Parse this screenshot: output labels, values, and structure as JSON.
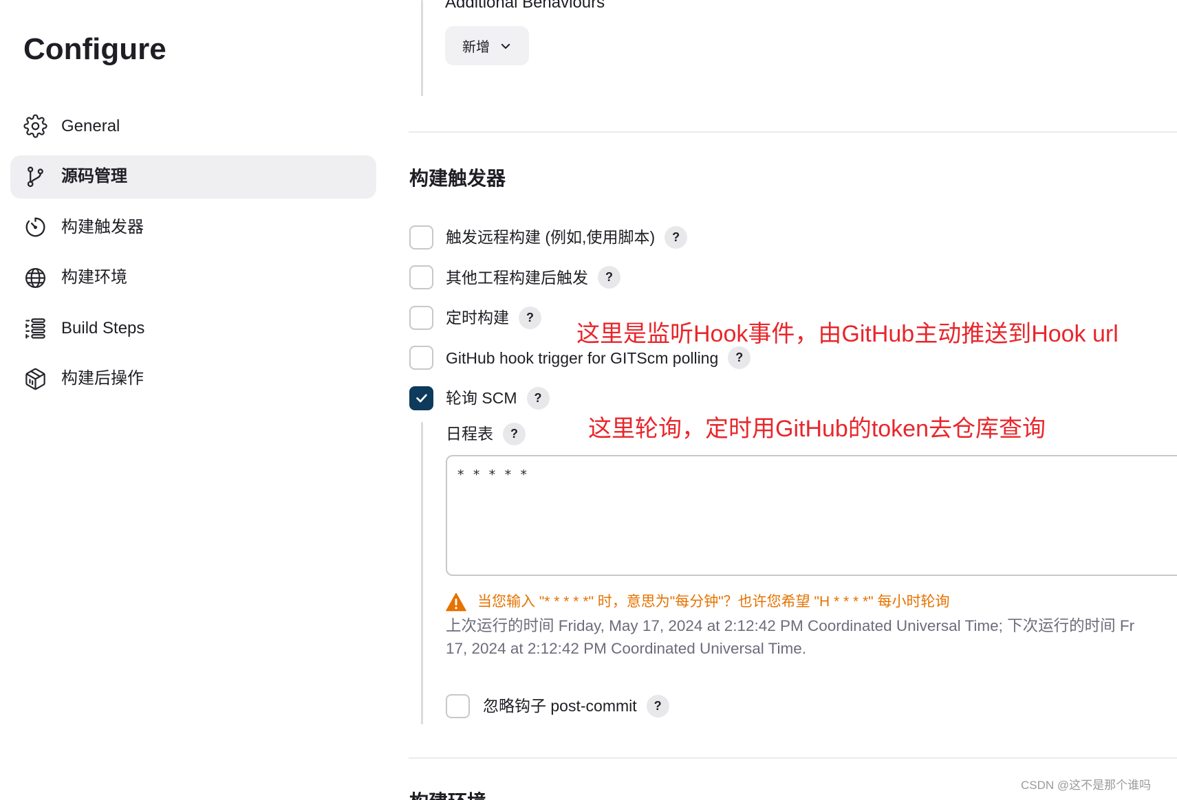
{
  "sidebar": {
    "title": "Configure",
    "items": [
      {
        "label": "General",
        "icon": "gear-icon",
        "active": false
      },
      {
        "label": "源码管理",
        "icon": "git-branch-icon",
        "active": true
      },
      {
        "label": "构建触发器",
        "icon": "timer-icon",
        "active": false
      },
      {
        "label": "构建环境",
        "icon": "globe-icon",
        "active": false
      },
      {
        "label": "Build Steps",
        "icon": "list-icon",
        "active": false
      },
      {
        "label": "构建后操作",
        "icon": "package-icon",
        "active": false
      }
    ]
  },
  "scm": {
    "additional_behaviours_label": "Additional Behaviours",
    "add_button_label": "新增",
    "add_button_icon": "chevron-down-icon"
  },
  "triggers": {
    "title": "构建触发器",
    "help_label": "?",
    "items": [
      {
        "label": "触发远程构建 (例如,使用脚本)",
        "checked": false
      },
      {
        "label": "其他工程构建后触发",
        "checked": false
      },
      {
        "label": "定时构建",
        "checked": false
      },
      {
        "label": "GitHub hook trigger for GITScm polling",
        "checked": false
      },
      {
        "label": "轮询 SCM",
        "checked": true
      }
    ],
    "schedule": {
      "label": "日程表",
      "value": "* * * * *",
      "warning_icon": "warning-icon",
      "warning": "当您输入 \"* * * * *\" 时，意思为\"每分钟\"？也许您希望 \"H * * * *\" 每小时轮询",
      "info_line1": "上次运行的时间 Friday, May 17, 2024 at 2:12:42 PM Coordinated Universal Time; 下次运行的时间 Fr",
      "info_line2": "17, 2024 at 2:12:42 PM Coordinated Universal Time."
    },
    "ignore_post_commit": {
      "label": "忽略钩子 post-commit",
      "checked": false
    }
  },
  "annotations": {
    "hook_note": "这里是监听Hook事件，由GitHub主动推送到Hook url",
    "poll_note": "这里轮询，定时用GitHub的token去仓库查询"
  },
  "next_section": {
    "title": "构建环境"
  },
  "watermark": "CSDN @这不是那个谁吗",
  "colors": {
    "text": "#1e1e24",
    "checkbox_checked": "#0e3a5b",
    "sidebar_active_bg": "#efeff2",
    "annotation": "#e8262b",
    "warning": "#e57300",
    "muted_text": "#6c6c7c"
  }
}
